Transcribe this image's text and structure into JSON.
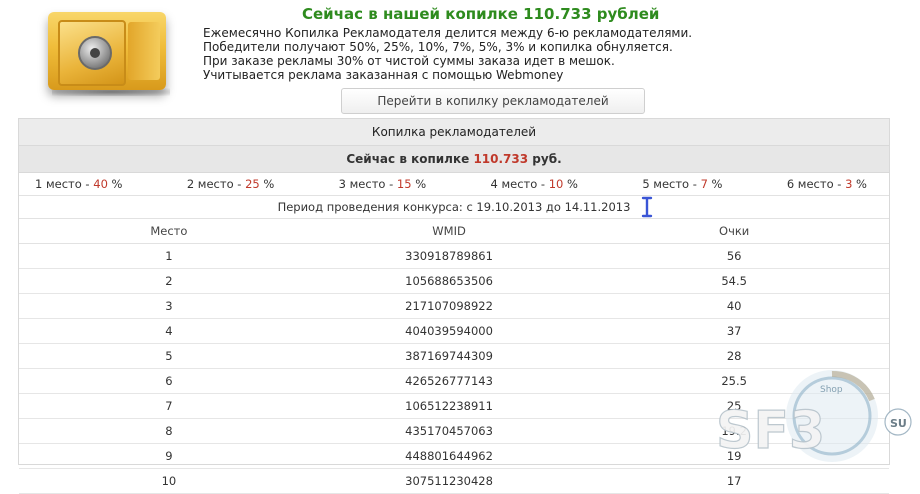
{
  "header": {
    "title": "Сейчас в нашей копилке 110.733 рублей",
    "lines": [
      "Ежемесячно Копилка Рекламодателя делится между 6-ю рекламодателями.",
      "Победители получают 50%, 25%, 10%, 7%, 5%, 3% и копилка обнуляется.",
      "При заказе рекламы 30% от чистой суммы заказа идет в мешок.",
      "Учитывается реклама заказанная с помощью Webmoney"
    ],
    "button_label": "Перейти в копилку рекламодателей"
  },
  "panel": {
    "title": "Копилка рекламодателей",
    "now_prefix": "Сейчас в копилке",
    "now_amount": "110.733",
    "now_suffix": "руб.",
    "places": [
      {
        "label": "1 место - ",
        "pct": "40",
        "suffix": " %"
      },
      {
        "label": "2 место - ",
        "pct": "25",
        "suffix": " %"
      },
      {
        "label": "3 место - ",
        "pct": "15",
        "suffix": " %"
      },
      {
        "label": "4 место - ",
        "pct": "10",
        "suffix": " %"
      },
      {
        "label": "5 место - ",
        "pct": "7",
        "suffix": " %"
      },
      {
        "label": "6 место - ",
        "pct": "3",
        "suffix": " %"
      }
    ],
    "period": "Период проведения конкурса: с 19.10.2013 до 14.11.2013",
    "columns": [
      "Место",
      "WMID",
      "Очки"
    ],
    "rows": [
      {
        "place": "1",
        "wmid": "330918789861",
        "points": "56"
      },
      {
        "place": "2",
        "wmid": "105688653506",
        "points": "54.5"
      },
      {
        "place": "3",
        "wmid": "217107098922",
        "points": "40"
      },
      {
        "place": "4",
        "wmid": "404039594000",
        "points": "37"
      },
      {
        "place": "5",
        "wmid": "387169744309",
        "points": "28"
      },
      {
        "place": "6",
        "wmid": "426526777143",
        "points": "25.5"
      },
      {
        "place": "7",
        "wmid": "106512238911",
        "points": "25"
      },
      {
        "place": "8",
        "wmid": "435170457063",
        "points": "19.2"
      },
      {
        "place": "9",
        "wmid": "448801644962",
        "points": "19"
      },
      {
        "place": "10",
        "wmid": "307511230428",
        "points": "17"
      }
    ]
  },
  "watermark": {
    "text": "SF3",
    "suffix": "SU",
    "shop": "Shop"
  },
  "colors": {
    "title_green": "#2e8b1e",
    "accent_red": "#c0392b",
    "cursor_blue": "#3a55d6"
  }
}
